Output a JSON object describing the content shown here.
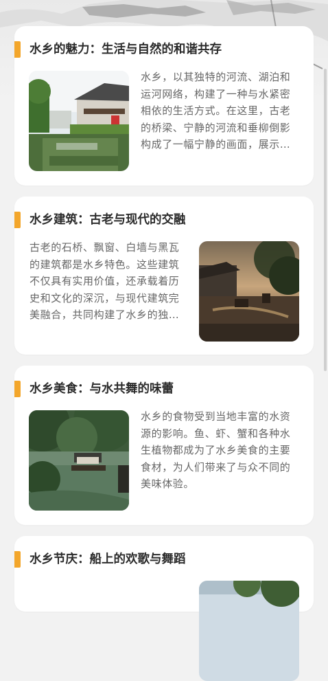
{
  "articles": [
    {
      "title": "水乡的魅力：生活与自然的和谐共存",
      "description": "水乡，以其独特的河流、湖泊和运河网络，构建了一种与水紧密相依的生活方式。在这里，古老的桥梁、宁静的河流和垂柳倒影构成了一幅宁静的画面，展示…",
      "image_position": "left"
    },
    {
      "title": "水乡建筑：古老与现代的交融",
      "description": "古老的石桥、飘窗、白墙与黑瓦的建筑都是水乡特色。这些建筑不仅具有实用价值，还承载着历史和文化的深沉，与现代建筑完美融合，共同构建了水乡的独…",
      "image_position": "right"
    },
    {
      "title": "水乡美食：与水共舞的味蕾",
      "description": "水乡的食物受到当地丰富的水资源的影响。鱼、虾、蟹和各种水生植物都成为了水乡美食的主要食材，为人们带来了与众不同的美味体验。",
      "image_position": "left"
    },
    {
      "title": "水乡节庆：船上的欢歌与舞蹈",
      "description": "",
      "image_position": "right"
    }
  ],
  "colors": {
    "accent": "#f3a62b",
    "title": "#2b2b2b",
    "text": "#666666",
    "background": "#f2f2f2",
    "card": "#ffffff"
  }
}
